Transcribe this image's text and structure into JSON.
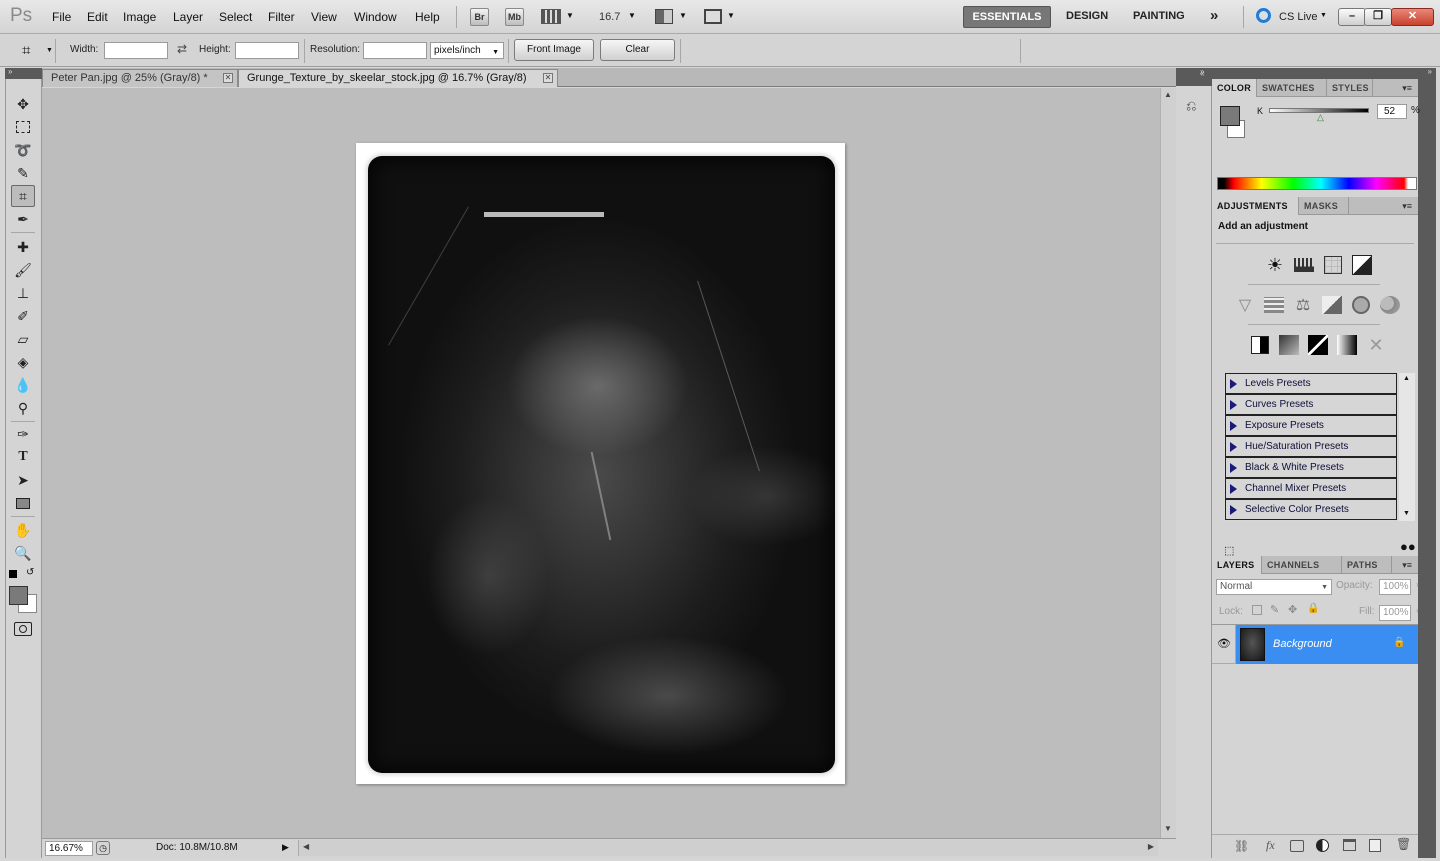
{
  "app": {
    "logo": "Ps"
  },
  "menu": [
    "File",
    "Edit",
    "Image",
    "Layer",
    "Select",
    "Filter",
    "View",
    "Window",
    "Help"
  ],
  "bridge_buttons": [
    "Br",
    "Mb"
  ],
  "zoom_select": "16.7",
  "workspaces": {
    "essentials": "ESSENTIALS",
    "design": "DESIGN",
    "painting": "PAINTING",
    "more": "»"
  },
  "cs_live": "CS Live",
  "window_controls": {
    "minimize": "–",
    "restore": "❐",
    "close": "✕"
  },
  "options": {
    "width_label": "Width:",
    "width_value": "",
    "height_label": "Height:",
    "height_value": "",
    "resolution_label": "Resolution:",
    "resolution_value": "",
    "resolution_unit": "pixels/inch",
    "front_image": "Front Image",
    "clear": "Clear"
  },
  "tabs": [
    {
      "title": "Peter Pan.jpg @ 25% (Gray/8) *",
      "close": "✕"
    },
    {
      "title": "Grunge_Texture_by_skeelar_stock.jpg @ 16.7% (Gray/8)",
      "close": "✕"
    }
  ],
  "status": {
    "zoom": "16.67%",
    "doc": "Doc: 10.8M/10.8M"
  },
  "color_panel": {
    "tabs": [
      "COLOR",
      "SWATCHES",
      "STYLES"
    ],
    "channel": "K",
    "value": "52",
    "unit": "%",
    "foreground": "#7a7a7a",
    "background": "#ffffff",
    "slider_fraction": 0.52
  },
  "adjustments_panel": {
    "tabs": [
      "ADJUSTMENTS",
      "MASKS"
    ],
    "heading": "Add an adjustment",
    "presets": [
      "Levels Presets",
      "Curves Presets",
      "Exposure Presets",
      "Hue/Saturation Presets",
      "Black & White Presets",
      "Channel Mixer Presets",
      "Selective Color Presets"
    ]
  },
  "layers_panel": {
    "tabs": [
      "LAYERS",
      "CHANNELS",
      "PATHS"
    ],
    "blend_mode": "Normal",
    "opacity_label": "Opacity:",
    "opacity": "100%",
    "lock_label": "Lock:",
    "fill_label": "Fill:",
    "fill": "100%",
    "layers": [
      {
        "name": "Background",
        "visible": true,
        "locked": true
      }
    ]
  },
  "colors": {
    "selection_blue": "#3a8ef2",
    "panel_bg": "#d4d4d4",
    "workspace_active": "#777777"
  }
}
